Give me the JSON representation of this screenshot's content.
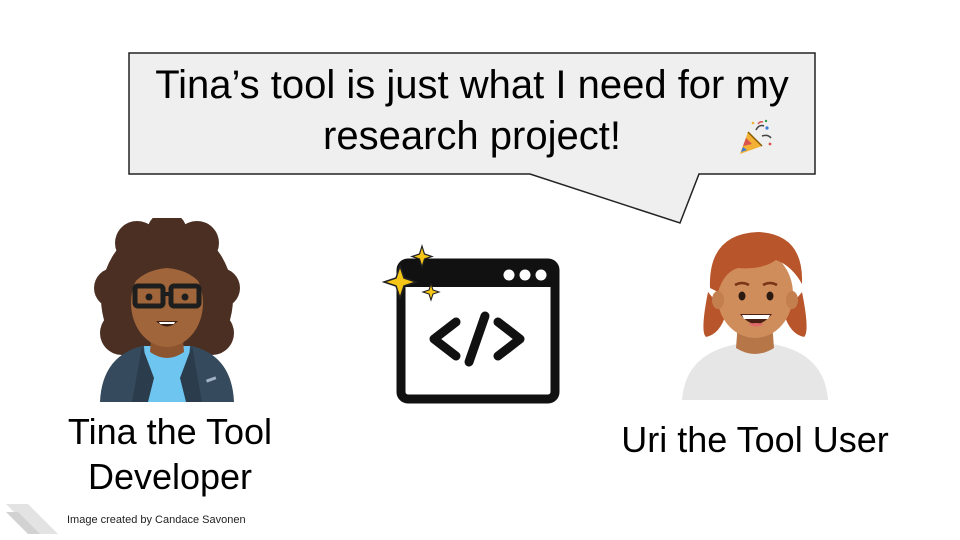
{
  "speech_bubble": {
    "line1": "Tina’s tool is just what I need for my",
    "line2": "research project!",
    "icon": "party-popper-icon"
  },
  "characters": {
    "developer": {
      "name_line1": "Tina the Tool",
      "name_line2": "Developer",
      "icon": "developer-avatar"
    },
    "user": {
      "name": "Uri the Tool User",
      "icon": "user-avatar"
    }
  },
  "center_icon": "code-window-sparkles-icon",
  "credit": "Image created by Candace Savonen",
  "colors": {
    "bubble_fill": "#efefef",
    "bubble_border": "#222222",
    "skin_tina": "#a0653a",
    "hair_tina": "#4a2f22",
    "shirt_tina": "#6ec6f0",
    "jacket_tina": "#354a5c",
    "skin_uri": "#d08d5c",
    "hair_uri": "#b9552a",
    "shirt_uri": "#e6e6e6",
    "sparkle": "#f5c518"
  }
}
